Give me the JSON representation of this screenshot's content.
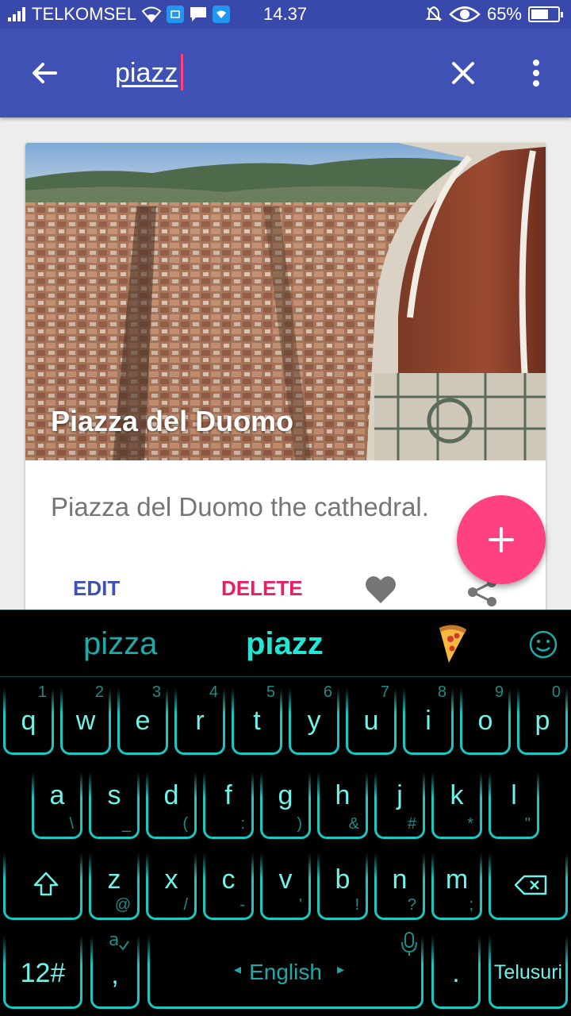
{
  "status_bar": {
    "carrier": "TELKOMSEL",
    "time": "14.37",
    "battery": "65%",
    "battery_level": 0.65
  },
  "app_bar": {
    "search_query": "piazz"
  },
  "card": {
    "title": "Piazza del Duomo",
    "description": "Piazza del Duomo the cathedral.",
    "edit_label": "EDIT",
    "delete_label": "DELETE"
  },
  "colors": {
    "primary": "#3F51B5",
    "status_bar": "#3949AB",
    "accent": "#FF4081",
    "keyboard_accent": "#1DE9D6"
  },
  "keyboard": {
    "suggestions": [
      "pizza",
      "piazz"
    ],
    "suggestion_emoji": "pizza-slice",
    "row1": [
      {
        "key": "q",
        "num": "1"
      },
      {
        "key": "w",
        "num": "2"
      },
      {
        "key": "e",
        "num": "3"
      },
      {
        "key": "r",
        "num": "4"
      },
      {
        "key": "t",
        "num": "5"
      },
      {
        "key": "y",
        "num": "6"
      },
      {
        "key": "u",
        "num": "7"
      },
      {
        "key": "i",
        "num": "8"
      },
      {
        "key": "o",
        "num": "9"
      },
      {
        "key": "p",
        "num": "0"
      }
    ],
    "row2": [
      {
        "key": "a",
        "alt": "\\"
      },
      {
        "key": "s",
        "alt": "_"
      },
      {
        "key": "d",
        "alt": "("
      },
      {
        "key": "f",
        "alt": ":"
      },
      {
        "key": "g",
        "alt": ")"
      },
      {
        "key": "h",
        "alt": "&"
      },
      {
        "key": "j",
        "alt": "#"
      },
      {
        "key": "k",
        "alt": "*"
      },
      {
        "key": "l",
        "alt": "\""
      }
    ],
    "row3": [
      {
        "key": "z",
        "alt": "@"
      },
      {
        "key": "x",
        "alt": "/"
      },
      {
        "key": "c",
        "alt": "-"
      },
      {
        "key": "v",
        "alt": "'"
      },
      {
        "key": "b",
        "alt": "!"
      },
      {
        "key": "n",
        "alt": "?"
      },
      {
        "key": "m",
        "alt": ";"
      }
    ],
    "symbols_label": "12#",
    "comma_label": ",",
    "space_label": "English",
    "period_label": ".",
    "enter_label": "Telusuri"
  }
}
